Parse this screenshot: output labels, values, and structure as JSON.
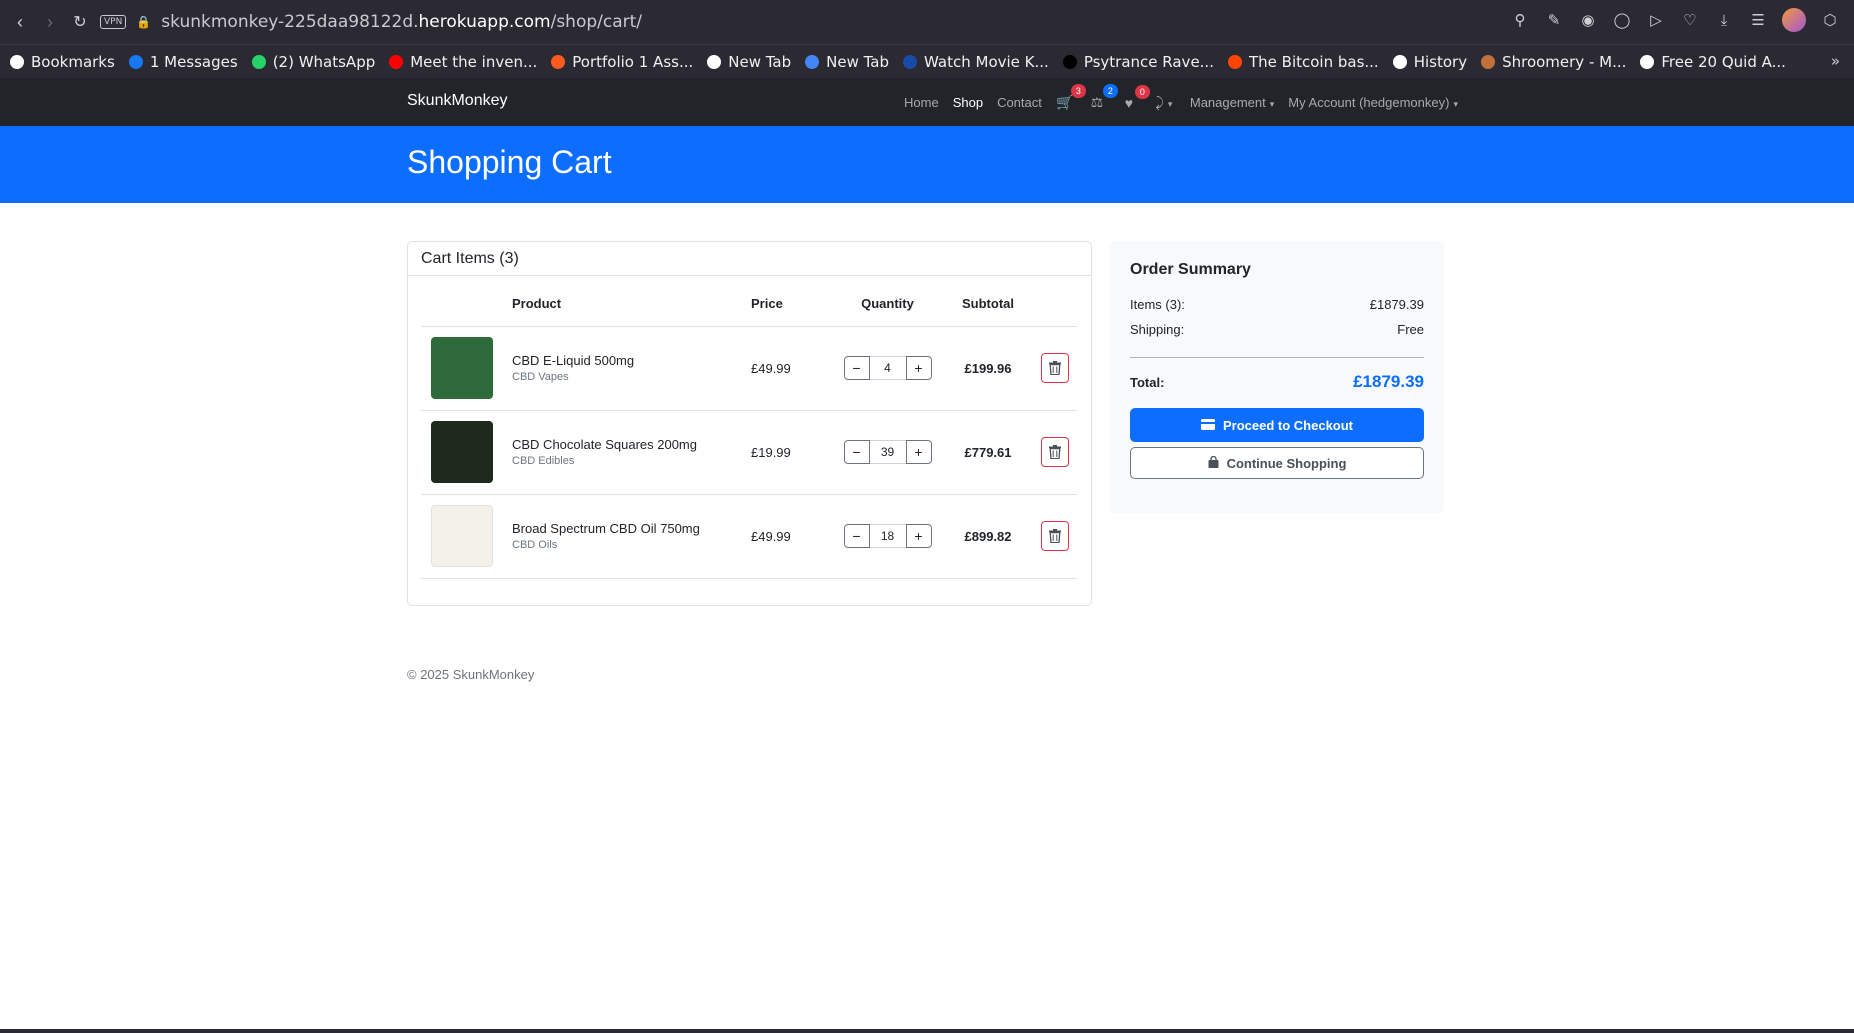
{
  "browser": {
    "url_prefix": "skunkmonkey-225daa98122d.",
    "url_host": "herokuapp.com",
    "url_path": "/shop/cart/",
    "vpn_label": "VPN"
  },
  "bookmarks": [
    {
      "label": "Bookmarks",
      "icon": "heart-icon",
      "color": "#ffffff"
    },
    {
      "label": "1 Messages",
      "icon": "facebook-icon",
      "color": "#1877f2"
    },
    {
      "label": "(2) WhatsApp",
      "icon": "whatsapp-icon",
      "color": "#25d366"
    },
    {
      "label": "Meet the inven...",
      "icon": "youtube-icon",
      "color": "#ff0000"
    },
    {
      "label": "Portfolio 1 Ass...",
      "icon": "circle-icon",
      "color": "#ff5a1f"
    },
    {
      "label": "New Tab",
      "icon": "page-icon",
      "color": "#ffffff"
    },
    {
      "label": "New Tab",
      "icon": "google-icon",
      "color": "#4285f4"
    },
    {
      "label": "Watch Movie K...",
      "icon": "movie-icon",
      "color": "#1a4aa8"
    },
    {
      "label": "Psytrance Rave...",
      "icon": "music-icon",
      "color": "#000000"
    },
    {
      "label": "The Bitcoin bas...",
      "icon": "reddit-icon",
      "color": "#ff4500"
    },
    {
      "label": "History",
      "icon": "clock-icon",
      "color": "#ffffff"
    },
    {
      "label": "Shroomery - M...",
      "icon": "mushroom-icon",
      "color": "#c0703a"
    },
    {
      "label": "Free 20 Quid A...",
      "icon": "page-icon",
      "color": "#ffffff"
    }
  ],
  "site": {
    "brand": "SkunkMonkey",
    "nav": {
      "home": "Home",
      "shop": "Shop",
      "contact": "Contact",
      "cart_count": "3",
      "compare_count": "2",
      "wishlist_count": "0",
      "management": "Management",
      "account": "My Account (hedgemonkey)"
    },
    "page_title": "Shopping Cart"
  },
  "cart": {
    "header": "Cart Items (3)",
    "columns": {
      "product": "Product",
      "price": "Price",
      "quantity": "Quantity",
      "subtotal": "Subtotal"
    },
    "items": [
      {
        "name": "CBD E-Liquid 500mg",
        "category": "CBD Vapes",
        "price": "£49.99",
        "quantity": "4",
        "subtotal": "£199.96",
        "thumb_color": "#2f6b3a"
      },
      {
        "name": "CBD Chocolate Squares 200mg",
        "category": "CBD Edibles",
        "price": "£19.99",
        "quantity": "39",
        "subtotal": "£779.61",
        "thumb_color": "#1e2a1e"
      },
      {
        "name": "Broad Spectrum CBD Oil 750mg",
        "category": "CBD Oils",
        "price": "£49.99",
        "quantity": "18",
        "subtotal": "£899.82",
        "thumb_color": "#f4f1ea"
      }
    ]
  },
  "summary": {
    "title": "Order Summary",
    "items_label": "Items (3):",
    "items_value": "£1879.39",
    "shipping_label": "Shipping:",
    "shipping_value": "Free",
    "total_label": "Total:",
    "total_value": "£1879.39",
    "checkout_label": "Proceed to Checkout",
    "continue_label": "Continue Shopping"
  },
  "footer": {
    "text": "© 2025 SkunkMonkey"
  },
  "colors": {
    "primary": "#0d6efd",
    "danger": "#dc3545",
    "navbar": "#212529"
  }
}
